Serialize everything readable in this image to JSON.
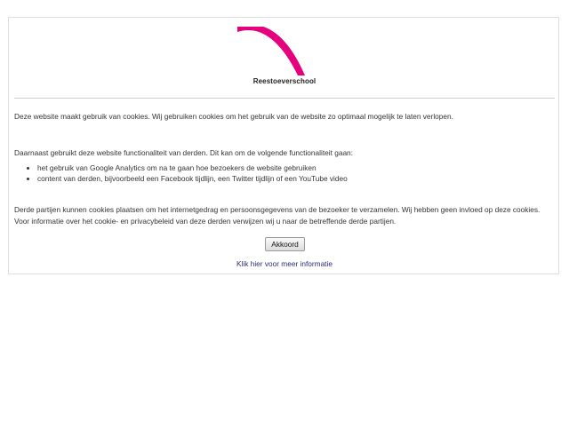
{
  "logo": {
    "name": "Reestoeverschool",
    "accent_color": "#e5007e"
  },
  "cookie_notice": {
    "paragraph_1": "Deze website maakt gebruik van cookies. Wij gebruiken cookies om het gebruik van de website zo optimaal mogelijk te laten verlopen.",
    "paragraph_2": "Daarnaast gebruikt deze website functionaliteit van derden. Dit kan om de volgende functionaliteit gaan:",
    "list_items": [
      "het gebruik van Google Analytics om na te gaan hoe bezoekers de website gebruiken",
      "content van derden, bijvoorbeeld een Facebook tijdlijn, een Twitter tijdlijn of een YouTube video"
    ],
    "paragraph_3": "Derde partijen kunnen cookies plaatsen om het internetgedrag en persoonsgegevens van de bezoeker te verzamelen. Wij hebben geen invloed op deze cookies. Voor informatie over het cookie- en privacybeleid van deze derden verwijzen wij u naar de betreffende derde partijen.",
    "accept_button_label": "Akkoord",
    "more_info_link": "Klik hier voor meer informatie"
  }
}
